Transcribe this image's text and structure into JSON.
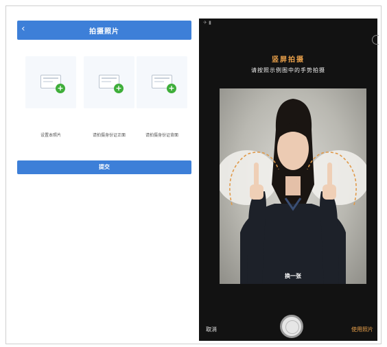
{
  "left": {
    "back_icon": "chevron-left-icon",
    "title": "拍摄照片",
    "slots": [
      {
        "label": "设置本照片"
      },
      {
        "label": "请拍摄身份证正面"
      },
      {
        "label": "请拍摄身份证背面"
      }
    ],
    "submit_label": "提交"
  },
  "right": {
    "heading": "竖屏拍摄",
    "subheading": "请按照示例图中的手势拍摄",
    "retake_label": "换一张",
    "cancel_label": "取消",
    "use_label": "使用照片"
  },
  "colors": {
    "nav_blue": "#3d7fd8",
    "accent_orange": "#e9a04a",
    "plus_green": "#3fae3a"
  }
}
